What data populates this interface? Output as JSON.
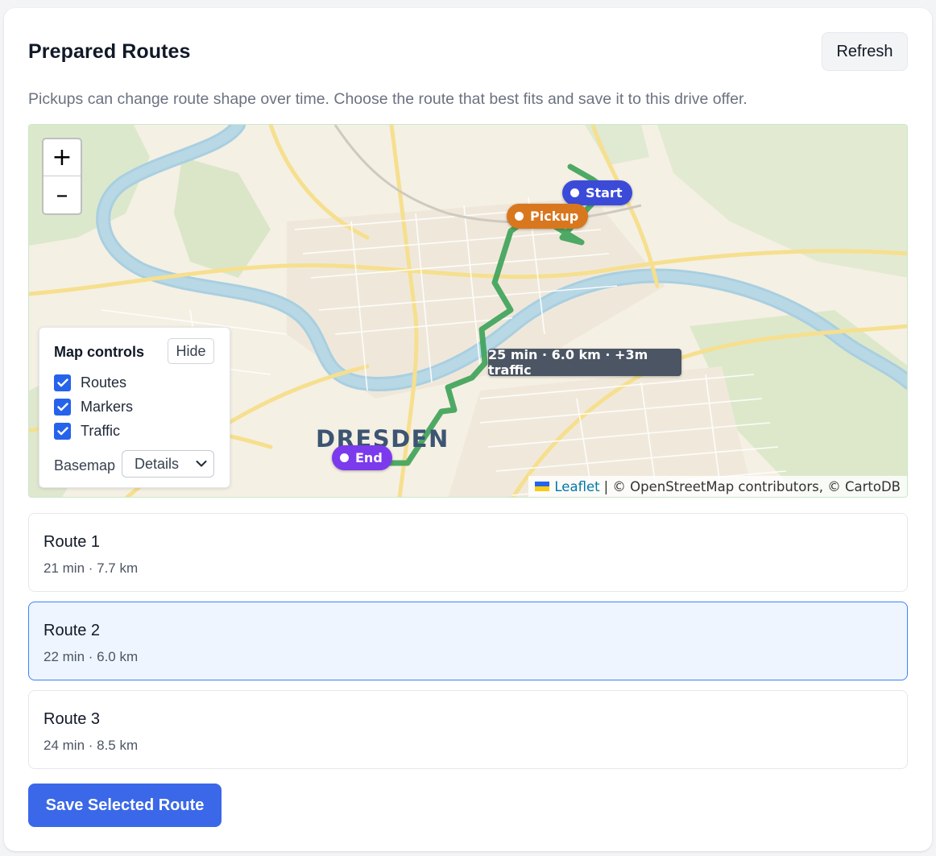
{
  "header": {
    "title": "Prepared Routes",
    "refresh_label": "Refresh",
    "subtitle": "Pickups can change route shape over time. Choose the route that best fits and save it to this drive offer."
  },
  "map": {
    "city_label": "DRESDEN",
    "zoom_in": "+",
    "zoom_out": "–",
    "markers": {
      "start": "Start",
      "pickup": "Pickup",
      "end": "End"
    },
    "marker_colors": {
      "start": "#3b4bd8",
      "pickup": "#d9771f",
      "end": "#7c3aed"
    },
    "route_color": "#3fa35a",
    "route_tooltip": "25 min · 6.0 km · +3m traffic",
    "attribution": {
      "leaflet": "Leaflet",
      "rest": "| © OpenStreetMap contributors, © CartoDB"
    },
    "controls": {
      "title": "Map controls",
      "hide_label": "Hide",
      "layers": [
        {
          "label": "Routes",
          "checked": true
        },
        {
          "label": "Markers",
          "checked": true
        },
        {
          "label": "Traffic",
          "checked": true
        }
      ],
      "basemap_label": "Basemap",
      "basemap_value": "Details"
    }
  },
  "routes": [
    {
      "name": "Route 1",
      "meta": "21 min · 7.7 km",
      "selected": false
    },
    {
      "name": "Route 2",
      "meta": "22 min · 6.0 km",
      "selected": true
    },
    {
      "name": "Route 3",
      "meta": "24 min · 8.5 km",
      "selected": false
    }
  ],
  "save_label": "Save Selected Route"
}
